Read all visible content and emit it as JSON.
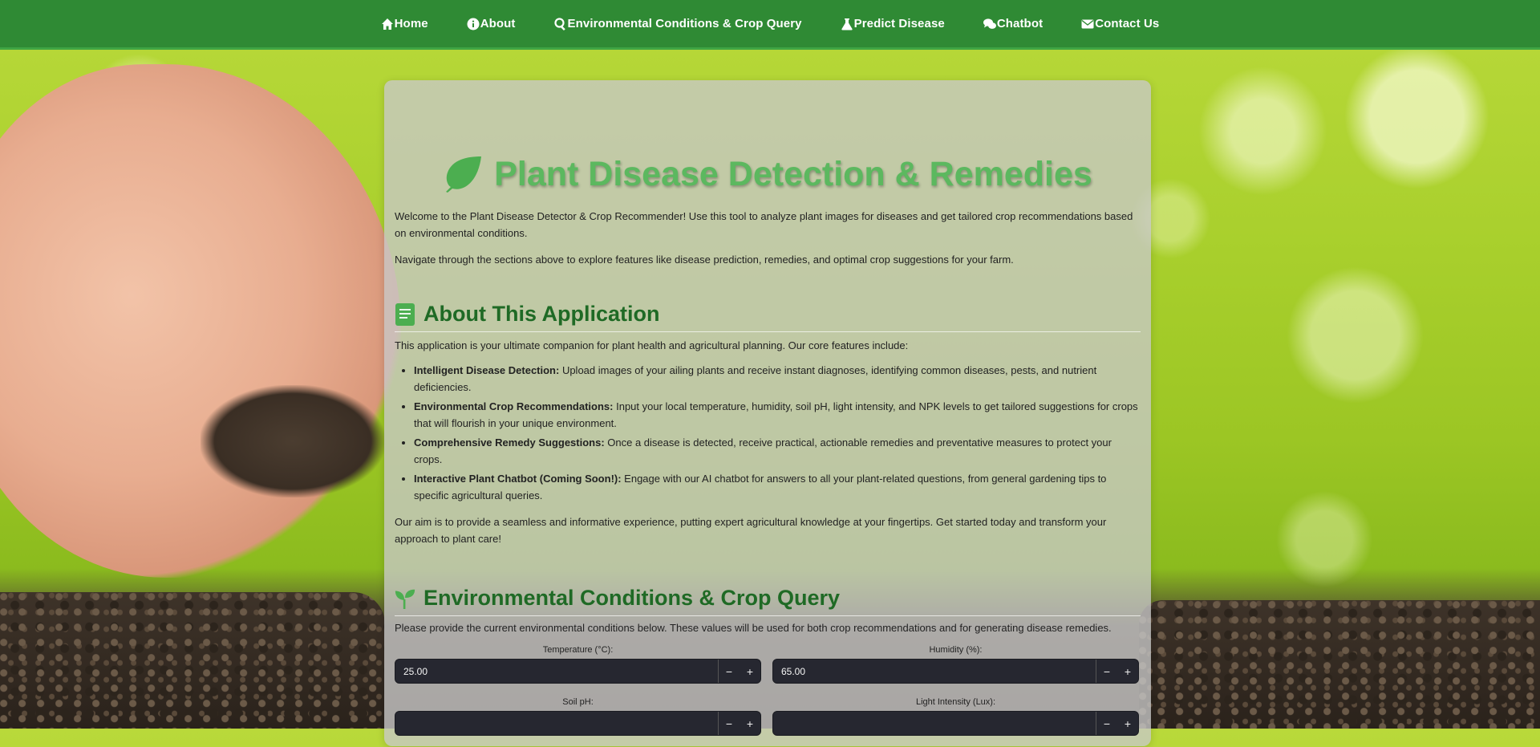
{
  "nav": {
    "items": [
      {
        "label": "Home",
        "icon": "home-icon"
      },
      {
        "label": "About",
        "icon": "info-icon"
      },
      {
        "label": "Environmental Conditions & Crop Query",
        "icon": "search-icon"
      },
      {
        "label": "Predict Disease",
        "icon": "flask-icon"
      },
      {
        "label": "Chatbot",
        "icon": "chat-icon"
      },
      {
        "label": "Contact Us",
        "icon": "envelope-icon"
      }
    ]
  },
  "main": {
    "title": "Plant Disease Detection & Remedies",
    "welcome": "Welcome to the Plant Disease Detector & Crop Recommender! Use this tool to analyze plant images for diseases and get tailored crop recommendations based on environmental conditions.",
    "nav_hint": "Navigate through the sections above to explore features like disease prediction, remedies, and optimal crop suggestions for your farm."
  },
  "about": {
    "heading": "About This Application",
    "intro": "This application is your ultimate companion for plant health and agricultural planning. Our core features include:",
    "features": [
      {
        "title": "Intelligent Disease Detection:",
        "text": " Upload images of your ailing plants and receive instant diagnoses, identifying common diseases, pests, and nutrient deficiencies."
      },
      {
        "title": "Environmental Crop Recommendations:",
        "text": " Input your local temperature, humidity, soil pH, light intensity, and NPK levels to get tailored suggestions for crops that will flourish in your unique environment."
      },
      {
        "title": "Comprehensive Remedy Suggestions:",
        "text": " Once a disease is detected, receive practical, actionable remedies and preventative measures to protect your crops."
      },
      {
        "title": "Interactive Plant Chatbot (Coming Soon!):",
        "text": " Engage with our AI chatbot for answers to all your plant-related questions, from general gardening tips to specific agricultural queries."
      }
    ],
    "aim": "Our aim is to provide a seamless and informative experience, putting expert agricultural knowledge at your fingertips. Get started today and transform your approach to plant care!"
  },
  "env": {
    "heading": "Environmental Conditions & Crop Query",
    "intro": "Please provide the current environmental conditions below. These values will be used for both crop recommendations and for generating disease remedies.",
    "fields": [
      {
        "label": "Temperature (°C):",
        "value": "25.00"
      },
      {
        "label": "Humidity (%):",
        "value": "65.00"
      },
      {
        "label": "Soil pH:",
        "value": ""
      },
      {
        "label": "Light Intensity (Lux):",
        "value": ""
      }
    ],
    "minus": "−",
    "plus": "+"
  },
  "colors": {
    "nav_bg": "#2f8a34",
    "title_green": "#5cb85f",
    "heading_green": "#1f6a25",
    "input_bg": "#262730"
  }
}
